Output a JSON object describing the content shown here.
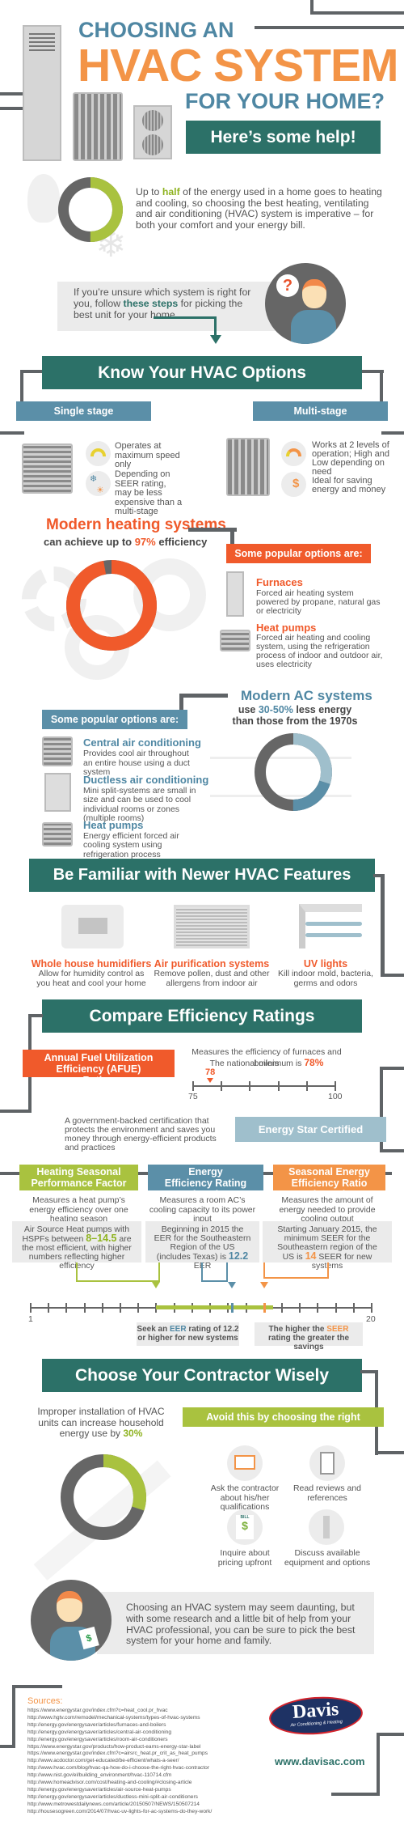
{
  "header": {
    "line1": "CHOOSING AN",
    "line2": "HVAC SYSTEM",
    "line3": "FOR YOUR HOME?",
    "banner": "Here’s some help!"
  },
  "intro": {
    "pre": "Up to ",
    "highlight": "half",
    "post": " of the energy used in a home goes to heating and cooling, so choosing the best heating, ventilating and air conditioning (HVAC) system is imperative – for both your comfort and your energy bill.",
    "donut_percent": 50
  },
  "steps": {
    "pre": "If you’re unsure which system is right for you, follow ",
    "highlight": "these steps",
    "post": " for picking the best unit for your home",
    "question_mark": "?"
  },
  "options": {
    "title": "Know Your HVAC Options",
    "single": {
      "label": "Single stage",
      "point1": "Operates at maximum speed only",
      "point2": "Depending on SEER rating, may be less expensive than a multi-stage"
    },
    "multi": {
      "label": "Multi-stage",
      "point1": "Works at 2 levels of operation; High and Low depending on need",
      "point2": "Ideal for saving energy and money",
      "dollar": "$"
    }
  },
  "heating": {
    "title": "Modern heating systems",
    "sub_pre": "can achieve up to ",
    "sub_highlight": "97%",
    "sub_post": " efficiency",
    "donut_percent": 97,
    "tab": "Some popular options are:",
    "items": [
      {
        "title": "Furnaces",
        "desc": "Forced air heating system powered by propane, natural gas or electricity"
      },
      {
        "title": "Heat pumps",
        "desc": "Forced air heating and cooling system, using the refrigeration process of indoor and outdoor air, uses electricity"
      }
    ]
  },
  "cooling": {
    "title": "Modern AC systems",
    "sub_pre": "use ",
    "sub_highlight": "30-50%",
    "sub_post": " less energy than those from the 1970s",
    "donut_segments": [
      30,
      20
    ],
    "tab": "Some popular options are:",
    "items": [
      {
        "title": "Central air conditioning",
        "desc": "Provides cool air throughout an entire house using a duct system"
      },
      {
        "title": "Ductless air conditioning",
        "desc": "Mini split-systems are small in size and can be used to cool individual rooms or zones (multiple rooms)"
      },
      {
        "title": "Heat pumps",
        "desc": "Energy efficient forced air cooling system using refrigeration process"
      }
    ]
  },
  "features": {
    "title": "Be Familiar with Newer HVAC Features",
    "items": [
      {
        "title": "Whole house humidifiers",
        "desc": "Allow for humidity control as you heat and cool your home"
      },
      {
        "title": "Air purification systems",
        "desc": "Remove pollen, dust and other allergens from indoor air"
      },
      {
        "title": "UV lights",
        "desc": "Kill indoor mold, bacteria, germs and odors"
      }
    ]
  },
  "ratings": {
    "title": "Compare Efficiency Ratings",
    "afue": {
      "label": "Annual Fuel Utilization Efficiency (AFUE) Rating",
      "desc": "Measures the efficiency of furnaces and boilers",
      "min_pre": "The national minimum is ",
      "min_value": "78%",
      "marker": "78",
      "scale_min": "75",
      "scale_max": "100"
    },
    "energy_star": {
      "label": "Energy Star Certified",
      "desc": "A government-backed certification that protects the environment and saves you money through energy-efficient products and practices"
    },
    "hspf": {
      "label": "Heating Seasonal Performance Factor (HSPF)",
      "desc": "Measures a heat pump’s energy efficiency over one heating season",
      "d_pre": "Air Source Heat pumps with HSPFs between ",
      "d_hl": "8–14.5",
      "d_post": " are the most efficient, with higher numbers reflecting higher efficiency",
      "color": "#a9c23f"
    },
    "eer": {
      "label": "Energy Efficiency Rating (EER)",
      "desc": "Measures a room AC’s cooling capacity to its power input",
      "d_pre": "Beginning in 2015 the EER for the Southeastern Region of the US (includes Texas) is ",
      "d_hl": "12.2",
      "d_post": " EER",
      "color": "#5b8fa8"
    },
    "seer": {
      "label": "Seasonal Energy Efficiency Ratio (SEER)",
      "desc": "Measures the amount of energy needed to provide cooling output",
      "d_pre": "Starting January 2015, the minimum SEER for the Southeastern region of the US is ",
      "d_hl": "14",
      "d_post": " SEER for new systems",
      "color": "#f39447"
    },
    "scale": {
      "min": "1",
      "max": "20",
      "hspf_range": [
        8,
        14.5
      ],
      "eer_mark": 12.2,
      "seer_mark": 14
    },
    "callout_eer": {
      "pre": "Seek an ",
      "hl": "EER",
      "post": " rating of 12.2 or higher for new systems"
    },
    "callout_seer": {
      "pre": "The higher the ",
      "hl": "SEER",
      "post": " rating the greater the savings"
    }
  },
  "contractor": {
    "title": "Choose Your Contractor Wisely",
    "stat_pre": "Improper installation of HVAC units can increase household energy use by ",
    "stat_hl": "30%",
    "donut_percent": 30,
    "tab": "Avoid this by choosing the right contractor",
    "tips": [
      "Ask the contractor about his/her qualifications",
      "Read reviews and references",
      "Inquire about pricing upfront",
      "Discuss available equipment and options"
    ],
    "bill_label": "BILL",
    "dollar": "$"
  },
  "closing": "Choosing an HVAC system may seem daunting, but with some research and a little bit of help from your HVAC professional, you can be sure to pick the best system for your home and family.",
  "sources": {
    "title": "Sources:",
    "links": [
      "https://www.energystar.gov/index.cfm?c=heat_cool.pr_hvac",
      "http://www.hgtv.com/remodel/mechanical-systems/types-of-hvac-systems",
      "http://energy.gov/energysaver/articles/furnaces-and-boilers",
      "http://energy.gov/energysaver/articles/central-air-conditioning",
      "http://energy.gov/energysaver/articles/room-air-conditioners",
      "https://www.energystar.gov/products/how-product-earns-energy-star-label",
      "https://www.energystar.gov/index.cfm?c=airsrc_heat.pr_crit_as_heat_pumps",
      "http://www.acdoctor.com/get-educated/be-efficient/whats-a-seer/",
      "http://www.hvac.com/blog/hvac-qa-how-do-i-choose-the-right-hvac-contractor",
      "http://www.nist.gov/el/building_environment/hvac-110714.cfm",
      "http://www.homeadvisor.com/cost/heating-and-cooling/#closing-article",
      "http://energy.gov/energysaver/articles/air-source-heat-pumps",
      "http://energy.gov/energysaver/articles/ductless-mini-split-air-conditioners",
      "http://www.metrowestdailynews.com/article/20150507/NEWS/150507214",
      "http://housesogreen.com/2014/07/hvac-uv-lights-for-ac-systems-do-they-work/"
    ]
  },
  "brand": {
    "logo_name": "Davis",
    "logo_tagline": "Air Conditioning & Heating",
    "url": "www.davisac.com"
  },
  "colors": {
    "teal": "#2c7168",
    "orange": "#f05a2b",
    "light_orange": "#f39447",
    "blue": "#5b8fa8",
    "light_blue": "#9fbfcc",
    "green": "#a9c23f",
    "gray": "#666666"
  }
}
